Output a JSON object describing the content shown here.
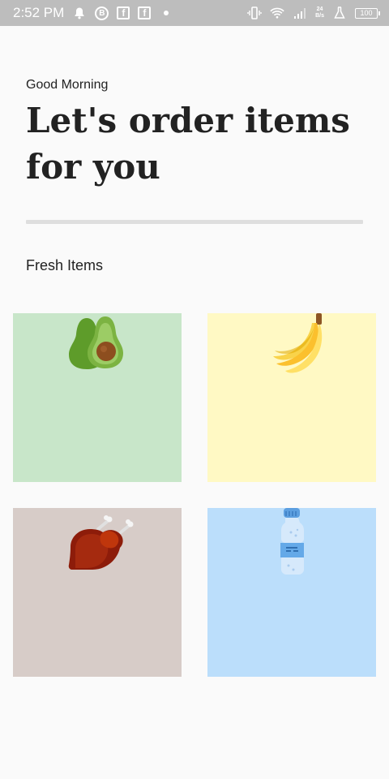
{
  "status_bar": {
    "time": "2:52 PM",
    "network_speed_value": "24",
    "network_speed_unit": "B/s",
    "battery": "100",
    "icons": [
      "bell-icon",
      "b-circle-icon",
      "facebook-icon",
      "facebook-icon",
      "dot-icon",
      "vibrate-icon",
      "wifi-icon",
      "signal-icon",
      "flask-icon",
      "battery-icon"
    ]
  },
  "header": {
    "greeting": "Good Morning",
    "headline_line1": "Let's order items",
    "headline_line2": "for you"
  },
  "section": {
    "title": "Fresh Items"
  },
  "items": [
    {
      "icon": "avocado-icon",
      "bg": "#c8e6c9"
    },
    {
      "icon": "banana-icon",
      "bg": "#fff9c4"
    },
    {
      "icon": "chicken-icon",
      "bg": "#d7ccc8"
    },
    {
      "icon": "water-bottle-icon",
      "bg": "#bbdefb"
    }
  ]
}
